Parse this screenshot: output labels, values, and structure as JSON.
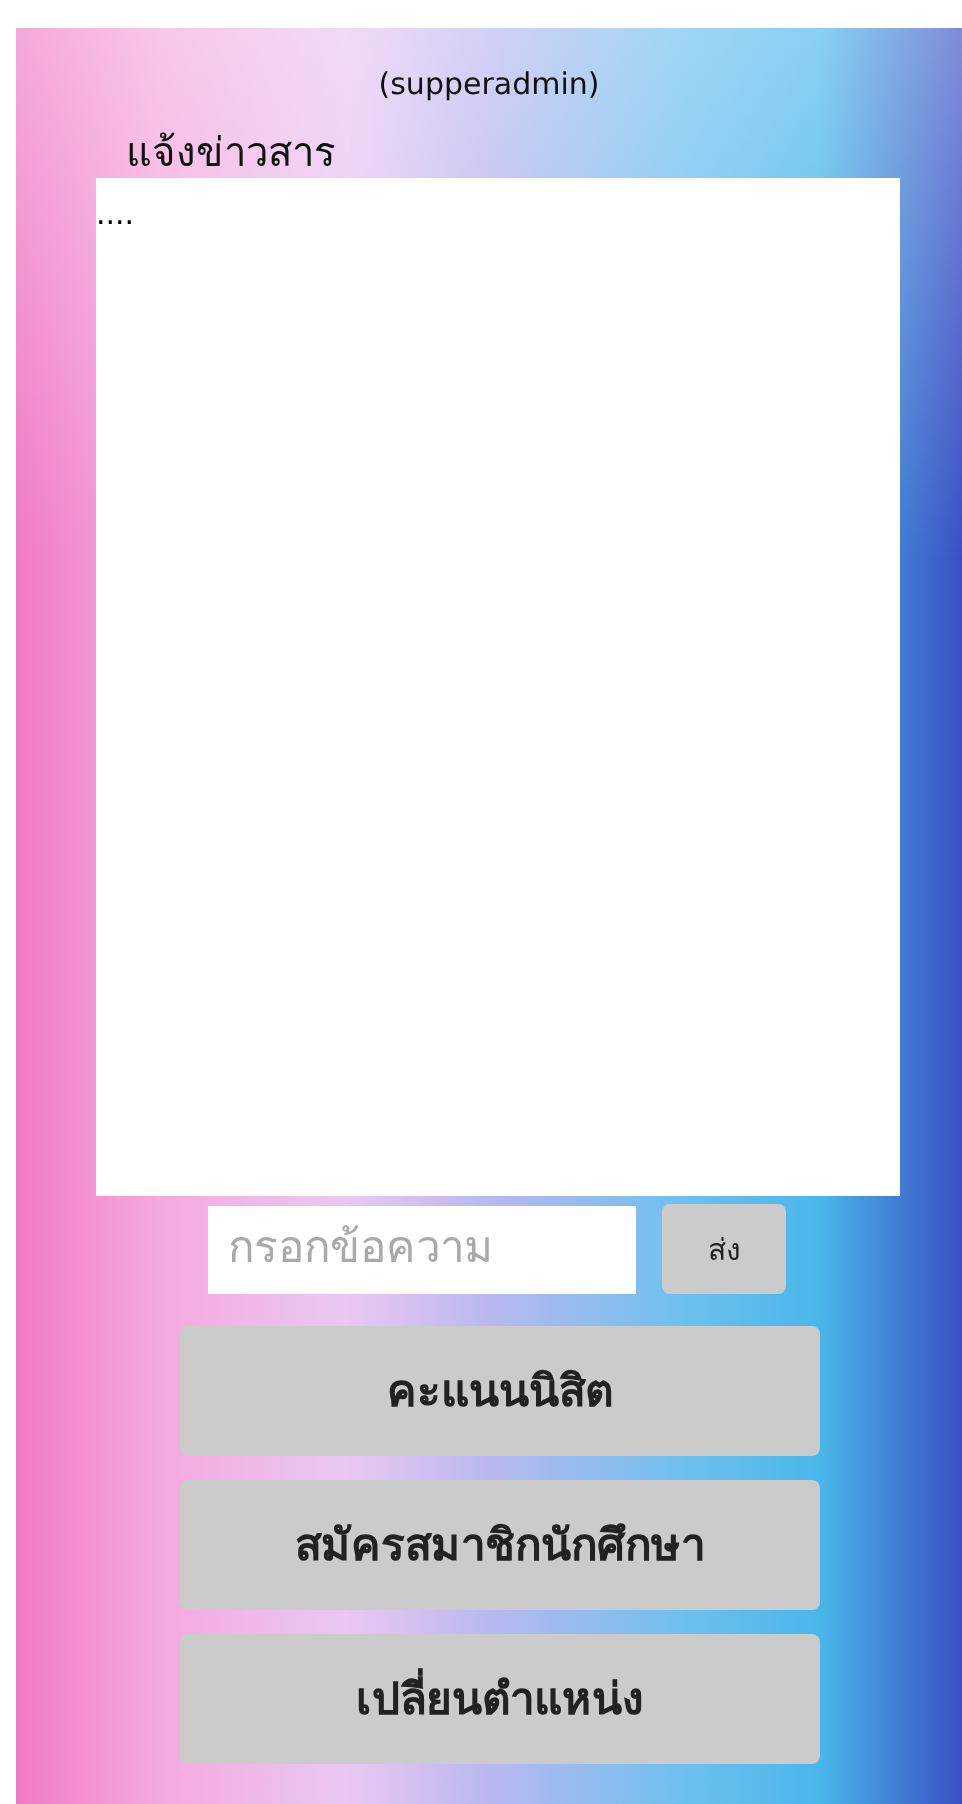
{
  "header": {
    "user": "(supperadmin)"
  },
  "news": {
    "title": "แจ้งข่าวสาร",
    "content": "...."
  },
  "composer": {
    "placeholder": "กรอกข้อความ",
    "send": "ส่ง"
  },
  "menu": [
    {
      "label": "คะแนนนิสิต"
    },
    {
      "label": "สมัครสมาชิกนักศึกษา"
    },
    {
      "label": "เปลี่ยนตำแหน่ง"
    }
  ]
}
